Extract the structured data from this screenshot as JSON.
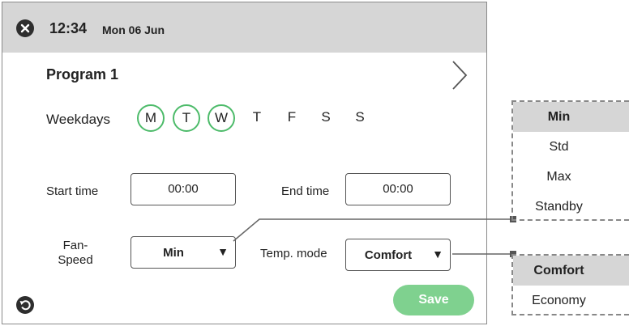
{
  "header": {
    "time": "12:34",
    "date": "Mon 06 Jun"
  },
  "program": {
    "title": "Program 1"
  },
  "weekdays": {
    "label": "Weekdays",
    "days": [
      {
        "letter": "M",
        "active": true
      },
      {
        "letter": "T",
        "active": true
      },
      {
        "letter": "W",
        "active": true
      },
      {
        "letter": "T",
        "active": false
      },
      {
        "letter": "F",
        "active": false
      },
      {
        "letter": "S",
        "active": false
      },
      {
        "letter": "S",
        "active": false
      }
    ]
  },
  "schedule": {
    "start_label": "Start time",
    "start_value": "00:00",
    "end_label": "End time",
    "end_value": "00:00"
  },
  "settings": {
    "fan_label_line1": "Fan-",
    "fan_label_line2": "Speed",
    "fan_value": "Min",
    "temp_label": "Temp. mode",
    "temp_value": "Comfort"
  },
  "actions": {
    "save_label": "Save"
  },
  "fan_options": [
    "Min",
    "Std",
    "Max",
    "Standby"
  ],
  "temp_options": [
    "Comfort",
    "Economy"
  ],
  "colors": {
    "accent_green": "#4dbb6a",
    "save_green": "#7fd18f",
    "header_gray": "#d6d6d6"
  },
  "icons": {
    "close": "close-icon",
    "next": "chevron-right-icon",
    "back": "back-arrow-icon",
    "dropdown": "caret-down-icon"
  }
}
